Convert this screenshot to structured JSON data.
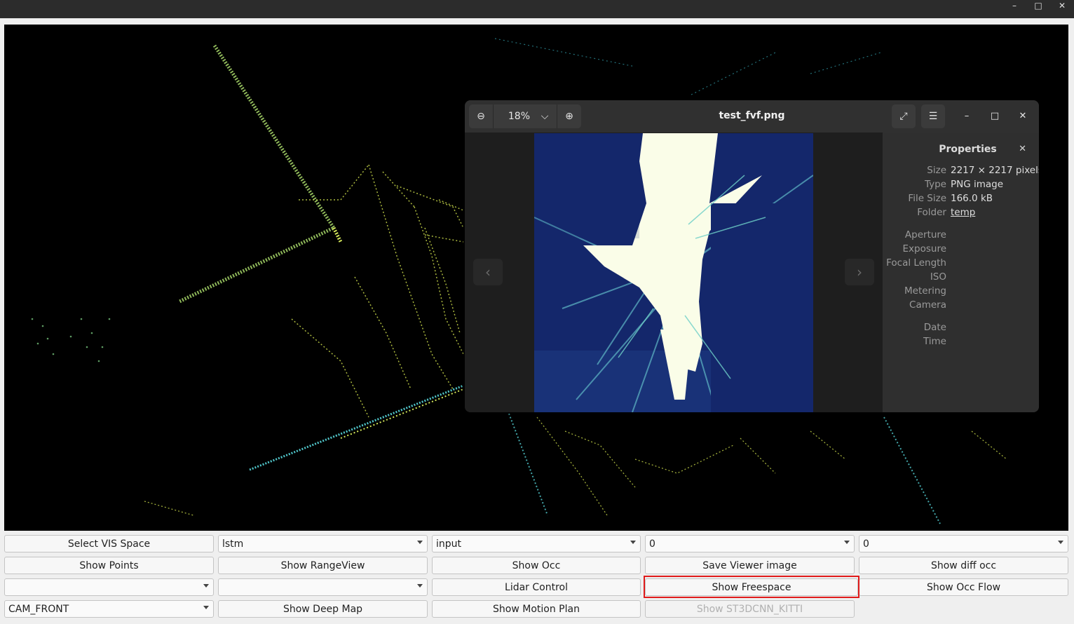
{
  "window": {
    "minimize_glyph": "–",
    "maximize_glyph": "□",
    "close_glyph": "✕"
  },
  "image_viewer": {
    "title": "test_fvf.png",
    "zoom_level": "18%",
    "zoom_out_glyph": "⊖",
    "zoom_in_glyph": "⊕",
    "dropdown_glyph": "⌵",
    "fullscreen_glyph": "⤢",
    "menu_glyph": "☰",
    "minimize_glyph": "–",
    "maximize_glyph": "□",
    "close_glyph": "✕",
    "prev_glyph": "‹",
    "next_glyph": "›",
    "properties": {
      "title": "Properties",
      "close_glyph": "✕",
      "size_label": "Size",
      "size_value": "2217 × 2217 pixels",
      "type_label": "Type",
      "type_value": "PNG image",
      "filesize_label": "File Size",
      "filesize_value": "166.0 kB",
      "folder_label": "Folder",
      "folder_value": "temp",
      "aperture_label": "Aperture",
      "exposure_label": "Exposure",
      "focal_label": "Focal Length",
      "iso_label": "ISO",
      "metering_label": "Metering",
      "camera_label": "Camera",
      "date_label": "Date",
      "time_label": "Time"
    }
  },
  "controls": {
    "row1": {
      "select_vis_space": "Select VIS Space",
      "combo_model": "lstm",
      "combo_input": "input",
      "combo_index_a": "0",
      "combo_index_b": "0"
    },
    "row2": {
      "show_points": "Show Points",
      "show_rangeview": "Show RangeView",
      "show_occ": "Show Occ",
      "save_viewer_image": "Save Viewer image",
      "show_diff_occ": "Show diff occ"
    },
    "row3": {
      "combo_empty_a": "",
      "combo_empty_b": "",
      "lidar_control": "Lidar Control",
      "show_freespace": "Show Freespace",
      "show_occ_flow": "Show Occ Flow"
    },
    "row4": {
      "combo_camera": "CAM_FRONT",
      "show_deep_map": "Show Deep Map",
      "show_motion_plan": "Show Motion Plan",
      "show_st3dcnn": "Show ST3DCNN_KITTI"
    }
  },
  "colors": {
    "highlight": "#e01b1b",
    "freespace_background": "#14276b",
    "freespace_open": "#fafde8",
    "pointcloud_near": "#d4e85a",
    "pointcloud_far": "#3bb9c8"
  }
}
